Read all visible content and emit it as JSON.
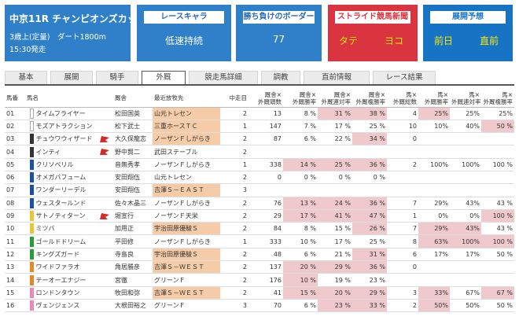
{
  "header": {
    "race": {
      "title": "中京11R チャンピオンズカップ",
      "condition": "3歳上(定量)　ダート1800m",
      "time": "15:30発走"
    },
    "chara": {
      "label": "レースキャラ",
      "value": "低速持続"
    },
    "border": {
      "label": "勝ち負けのボーダー",
      "value": "77"
    },
    "news": {
      "label": "ストライド競馬新聞",
      "tate": "タテ",
      "yoko": "ヨコ"
    },
    "tenkai": {
      "label": "展開予想",
      "zenjitsu": "前日",
      "chokuzen": "直前"
    }
  },
  "tabs": [
    "基本",
    "展開",
    "騎手",
    "外厩",
    "競走馬詳細",
    "調教",
    "直前情報",
    "レース結果"
  ],
  "active_tab": "外厩",
  "table": {
    "headers": [
      "馬番",
      "馬名",
      "厩舎",
      "最近放牧先",
      "中走目",
      "厩舎×\n外厩頭数",
      "厩舎×\n外厩勝率",
      "厩舎×\n外厩連対率",
      "厩舎×\n外厩複勝率",
      "馬×\n外厩総数",
      "馬×\n外厩勝率",
      "馬×\n外厩連対率",
      "馬×\n外厩複勝率"
    ],
    "rows": [
      {
        "no": "01",
        "name": "タイムフライヤー",
        "trainer": "松田国英",
        "farm": "山元トレセン",
        "chuso": "2",
        "a": "13",
        "b": "8 %",
        "c": "31 %",
        "d": "38 %",
        "e": "4",
        "f": "25%",
        "g": "25%",
        "h": "25%",
        "color": "#ffffff",
        "farmBg": true,
        "hl": [
          "c",
          "d",
          "f"
        ],
        "flag": false
      },
      {
        "no": "02",
        "name": "モズアトラクション",
        "trainer": "松下武士",
        "farm": "三重ホースＴＣ",
        "chuso": "1",
        "a": "147",
        "b": "7 %",
        "c": "17 %",
        "d": "25 %",
        "e": "10",
        "f": "10%",
        "g": "40%",
        "h": "50 %",
        "color": "#ffffff",
        "farmBg": true,
        "hl": [
          "h"
        ],
        "flag": false
      },
      {
        "no": "03",
        "name": "チュウワウィザード",
        "trainer": "大久保龍志",
        "farm": "ノーザンＦしがらき",
        "chuso": "2",
        "a": "87",
        "b": "6 %",
        "c": "22 %",
        "d": "34 %",
        "e": "0",
        "f": "",
        "g": "",
        "h": "",
        "color": "#333333",
        "farmBg": true,
        "hl": [
          "d"
        ],
        "flag": true
      },
      {
        "no": "04",
        "name": "インティ",
        "trainer": "野中賢二",
        "farm": "武田ステーブル",
        "chuso": "2",
        "a": "",
        "b": "",
        "c": "",
        "d": "",
        "e": "",
        "f": "",
        "g": "",
        "h": "",
        "color": "#333333",
        "farmBg": false,
        "hl": [],
        "flag": true
      },
      {
        "no": "05",
        "name": "クリソベリル",
        "trainer": "音無秀孝",
        "farm": "ノーザンＦしがらき",
        "chuso": "1",
        "a": "338",
        "b": "14 %",
        "c": "25 %",
        "d": "36 %",
        "e": "2",
        "f": "100%",
        "g": "100%",
        "h": "100 %",
        "color": "#1c4fa8",
        "farmBg": false,
        "hl": [
          "b",
          "c",
          "d"
        ],
        "flag": false
      },
      {
        "no": "06",
        "name": "オメガパフューム",
        "trainer": "安田翔伍",
        "farm": "山元トレセン",
        "chuso": "2",
        "a": "0",
        "b": "0 %",
        "c": "0 %",
        "d": "0 %",
        "e": "",
        "f": "",
        "g": "",
        "h": "",
        "color": "#1c4fa8",
        "farmBg": false,
        "hl": [],
        "flag": false
      },
      {
        "no": "07",
        "name": "ワンダーリーデル",
        "trainer": "安田翔伍",
        "farm": "吉澤Ｓ－ＥＡＳＴ",
        "chuso": "3",
        "a": "",
        "b": "",
        "c": "",
        "d": "",
        "e": "",
        "f": "",
        "g": "",
        "h": "",
        "color": "#1c4fa8",
        "farmBg": true,
        "hl": [],
        "flag": false
      },
      {
        "no": "08",
        "name": "ウェスタールンド",
        "trainer": "佐々木晶三",
        "farm": "ノーザンＦしがらき",
        "chuso": "2",
        "a": "76",
        "b": "13 %",
        "c": "24 %",
        "d": "36 %",
        "e": "7",
        "f": "29%",
        "g": "43%",
        "h": "43 %",
        "color": "#1c4fa8",
        "farmBg": false,
        "hl": [
          "b",
          "c",
          "d"
        ],
        "flag": false
      },
      {
        "no": "09",
        "name": "サトノティターン",
        "trainer": "堀宣行",
        "farm": "ノーザンＦ天栄",
        "chuso": "2",
        "a": "29",
        "b": "17 %",
        "c": "41 %",
        "d": "47 %",
        "e": "1",
        "f": "0%",
        "g": "0%",
        "h": "100 %",
        "color": "#e8c832",
        "farmBg": false,
        "hl": [
          "b",
          "c",
          "d",
          "h"
        ],
        "flag": true
      },
      {
        "no": "10",
        "name": "ミツバ",
        "trainer": "加用正",
        "farm": "宇治田原優駿Ｓ",
        "chuso": "2",
        "a": "84",
        "b": "8 %",
        "c": "15 %",
        "d": "26 %",
        "e": "7",
        "f": "29%",
        "g": "43%",
        "h": "43 %",
        "color": "#e8c832",
        "farmBg": true,
        "hl": [
          "d",
          "f",
          "g"
        ],
        "flag": false
      },
      {
        "no": "11",
        "name": "ゴールドドリーム",
        "trainer": "平田修",
        "farm": "ノーザンＦしがらき",
        "chuso": "1",
        "a": "333",
        "b": "10 %",
        "c": "17 %",
        "d": "25 %",
        "e": "8",
        "f": "63%",
        "g": "100%",
        "h": "100 %",
        "color": "#2a9a3c",
        "farmBg": false,
        "hl": [
          "f",
          "g",
          "h"
        ],
        "flag": false
      },
      {
        "no": "12",
        "name": "キングズガード",
        "trainer": "寺島良",
        "farm": "宇治田原優駿Ｓ",
        "chuso": "2",
        "a": "48",
        "b": "6 %",
        "c": "21 %",
        "d": "31 %",
        "e": "6",
        "f": "17%",
        "g": "17%",
        "h": "50 %",
        "color": "#2a9a3c",
        "farmBg": true,
        "hl": [
          "d"
        ],
        "flag": false
      },
      {
        "no": "13",
        "name": "ワイドファラオ",
        "trainer": "角居勝彦",
        "farm": "吉澤Ｓ－ＷＥＳＴ",
        "chuso": "2",
        "a": "137",
        "b": "20 %",
        "c": "29 %",
        "d": "36 %",
        "e": "0",
        "f": "",
        "g": "",
        "h": "",
        "color": "#e08a28",
        "farmBg": true,
        "hl": [
          "b",
          "c",
          "d"
        ],
        "flag": false
      },
      {
        "no": "14",
        "name": "テーオーエナジー",
        "trainer": "宮徹",
        "farm": "グリーンＦ",
        "chuso": "2",
        "a": "176",
        "b": "10 %",
        "c": "19 %",
        "d": "23 %",
        "e": "",
        "f": "",
        "g": "",
        "h": "",
        "color": "#e08a28",
        "farmBg": false,
        "hl": [
          "b"
        ],
        "flag": false
      },
      {
        "no": "15",
        "name": "ロンドンタウン",
        "trainer": "牧田和弥",
        "farm": "吉澤Ｓ－ＷＥＳＴ",
        "chuso": "2",
        "a": "41",
        "b": "15 %",
        "c": "20 %",
        "d": "29 %",
        "e": "3",
        "f": "33%",
        "g": "67%",
        "h": "67 %",
        "color": "#e88ab8",
        "farmBg": true,
        "hl": [
          "b",
          "c",
          "d",
          "f",
          "h"
        ],
        "flag": false
      },
      {
        "no": "16",
        "name": "ヴェンジェンス",
        "trainer": "大根田裕之",
        "farm": "グリーンＦ",
        "chuso": "3",
        "a": "70",
        "b": "6 %",
        "c": "23 %",
        "d": "33 %",
        "e": "2",
        "f": "50%",
        "g": "50%",
        "h": "50 %",
        "color": "#e88ab8",
        "farmBg": false,
        "hl": [
          "c",
          "d",
          "f"
        ],
        "flag": false
      }
    ]
  },
  "colors": {
    "race_box": "#2f80c8",
    "news_box": "#d9343f",
    "tenkai_box": "#1773c4",
    "highlight": "#f0c9cc",
    "farm_highlight": "#f6cca8",
    "flag": "#d42a2a"
  }
}
